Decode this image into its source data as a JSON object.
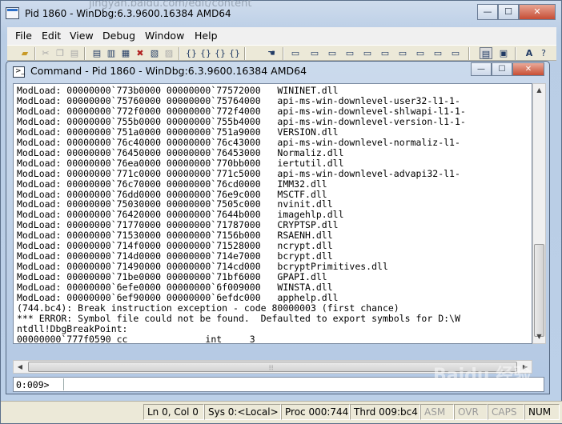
{
  "background_url": "jingyan.baidu.com/edit/content",
  "window": {
    "title": "Pid 1860 - WinDbg:6.3.9600.16384 AMD64",
    "controls": {
      "minimize": "—",
      "maximize": "☐",
      "close": "✕"
    }
  },
  "menu": [
    "File",
    "Edit",
    "View",
    "Debug",
    "Window",
    "Help"
  ],
  "child": {
    "title": "Command - Pid 1860 - WinDbg:6.3.9600.16384 AMD64",
    "icon_glyph": ">_",
    "controls": {
      "minimize": "—",
      "maximize": "☐",
      "close": "✕"
    },
    "output_lines": [
      "ModLoad: 00000000`773b0000 00000000`77572000   WININET.dll",
      "ModLoad: 00000000`75760000 00000000`75764000   api-ms-win-downlevel-user32-l1-1-",
      "ModLoad: 00000000`772f0000 00000000`772f4000   api-ms-win-downlevel-shlwapi-l1-1-",
      "ModLoad: 00000000`755b0000 00000000`755b4000   api-ms-win-downlevel-version-l1-1-",
      "ModLoad: 00000000`751a0000 00000000`751a9000   VERSION.dll",
      "ModLoad: 00000000`76c40000 00000000`76c43000   api-ms-win-downlevel-normaliz-l1-",
      "ModLoad: 00000000`76450000 00000000`76453000   Normaliz.dll",
      "ModLoad: 00000000`76ea0000 00000000`770bb000   iertutil.dll",
      "ModLoad: 00000000`771c0000 00000000`771c5000   api-ms-win-downlevel-advapi32-l1-",
      "ModLoad: 00000000`76c70000 00000000`76cd0000   IMM32.dll",
      "ModLoad: 00000000`76dd0000 00000000`76e9c000   MSCTF.dll",
      "ModLoad: 00000000`75030000 00000000`7505c000   nvinit.dll",
      "ModLoad: 00000000`76420000 00000000`7644b000   imagehlp.dll",
      "ModLoad: 00000000`71770000 00000000`71787000   CRYPTSP.dll",
      "ModLoad: 00000000`71530000 00000000`7156b000   RSAENH.dll",
      "ModLoad: 00000000`714f0000 00000000`71528000   ncrypt.dll",
      "ModLoad: 00000000`714d0000 00000000`714e7000   bcrypt.dll",
      "ModLoad: 00000000`71490000 00000000`714cd000   bcryptPrimitives.dll",
      "ModLoad: 00000000`71be0000 00000000`71bf6000   GPAPI.dll",
      "ModLoad: 00000000`6efe0000 00000000`6f009000   WINSTA.dll",
      "ModLoad: 00000000`6ef90000 00000000`6efdc000   apphelp.dll",
      "(744.bc4): Break instruction exception - code 80000003 (first chance)",
      "*** ERROR: Symbol file could not be found.  Defaulted to export symbols for D:\\W",
      "ntdll!DbgBreakPoint:",
      "00000000`777f0590 cc              int     3"
    ],
    "prompt": "0:009>",
    "command_value": ""
  },
  "status": {
    "position": "Ln 0, Col 0",
    "sys": "Sys 0:<Local>",
    "proc": "Proc 000:744",
    "thrd": "Thrd 009:bc4",
    "asm": "ASM",
    "ovr": "OVR",
    "caps": "CAPS",
    "num": "NUM"
  },
  "watermark": "Baidu 经验"
}
